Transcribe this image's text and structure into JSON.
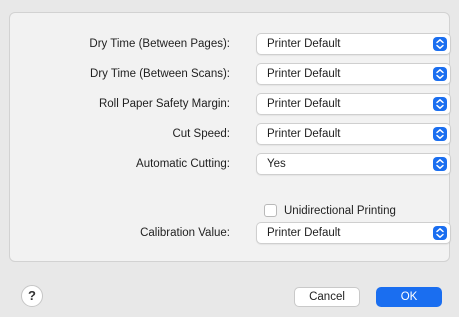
{
  "settings": [
    {
      "label": "Dry Time (Between Pages):",
      "value": "Printer Default"
    },
    {
      "label": "Dry Time (Between Scans):",
      "value": "Printer Default"
    },
    {
      "label": "Roll Paper Safety Margin:",
      "value": "Printer Default"
    },
    {
      "label": "Cut Speed:",
      "value": "Printer Default"
    },
    {
      "label": "Automatic Cutting:",
      "value": "Yes"
    }
  ],
  "unidirectional": {
    "label": "Unidirectional Printing",
    "checked": false
  },
  "calibration": {
    "label": "Calibration Value:",
    "value": "Printer Default"
  },
  "footer": {
    "help": "?",
    "cancel": "Cancel",
    "ok": "OK"
  },
  "colors": {
    "accent": "#1a6ef0",
    "panel": "#f2f2f2",
    "window": "#e8e8e8"
  },
  "icons": {
    "popup_arrows": "up-down-chevron-icon",
    "help": "question-mark-icon"
  }
}
